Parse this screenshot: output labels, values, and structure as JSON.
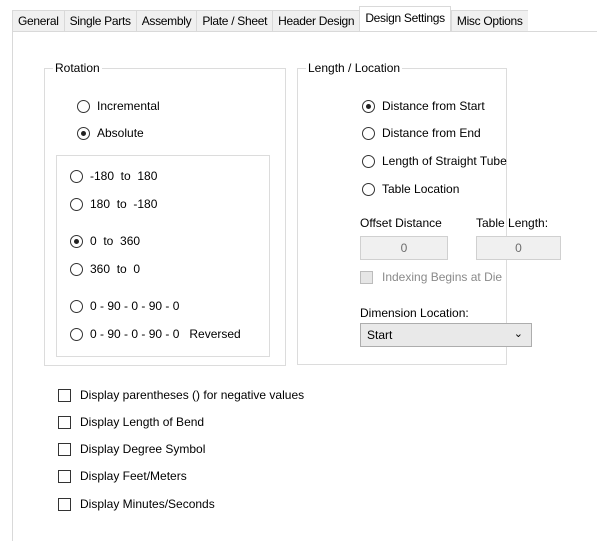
{
  "tabs": [
    {
      "label": "General"
    },
    {
      "label": "Single Parts"
    },
    {
      "label": "Assembly"
    },
    {
      "label": "Plate / Sheet"
    },
    {
      "label": "Header Design"
    },
    {
      "label": "Design Settings",
      "active": true
    },
    {
      "label": "Misc Options"
    }
  ],
  "rotation": {
    "title": "Rotation",
    "mode": [
      {
        "label": "Incremental",
        "checked": false
      },
      {
        "label": "Absolute",
        "checked": true
      }
    ],
    "ranges": [
      {
        "label": "-180  to  180",
        "checked": false
      },
      {
        "label": "180  to  -180",
        "checked": false
      },
      {
        "label": "0  to  360",
        "checked": true
      },
      {
        "label": "360  to  0",
        "checked": false
      },
      {
        "label": "0 - 90 - 0 - 90 - 0",
        "checked": false
      },
      {
        "label": "0 - 90 - 0 - 90 - 0   Reversed",
        "checked": false
      }
    ]
  },
  "length": {
    "title": "Length / Location",
    "options": [
      {
        "label": "Distance from Start",
        "checked": true
      },
      {
        "label": "Distance from End",
        "checked": false
      },
      {
        "label": "Length of Straight Tube",
        "checked": false
      },
      {
        "label": "Table Location",
        "checked": false
      }
    ],
    "offset_label": "Offset Distance",
    "offset_value": "0",
    "table_length_label": "Table Length:",
    "table_length_value": "0",
    "indexing_label": "Indexing Begins at Die",
    "dimension_label": "Dimension Location:",
    "dimension_value": "Start"
  },
  "checkboxes": [
    {
      "label": "Display parentheses () for negative values",
      "checked": false
    },
    {
      "label": "Display Length of Bend",
      "checked": false
    },
    {
      "label": "Display Degree Symbol",
      "checked": false
    },
    {
      "label": "Display Feet/Meters",
      "checked": false
    },
    {
      "label": "Display Minutes/Seconds",
      "checked": false
    }
  ]
}
